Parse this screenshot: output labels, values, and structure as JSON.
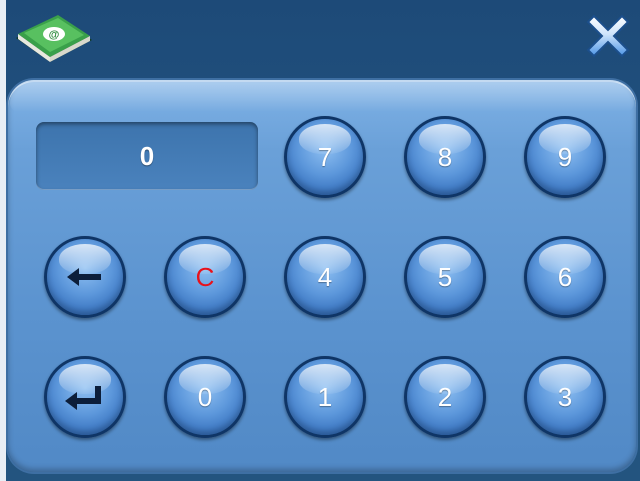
{
  "display": {
    "value": "0"
  },
  "keypad": {
    "row1": [
      "7",
      "8",
      "9"
    ],
    "row2": [
      "C",
      "4",
      "5",
      "6"
    ],
    "row3": [
      "0",
      "1",
      "2",
      "3"
    ]
  },
  "colors": {
    "background": "#23547f",
    "panel": "#5b93cf",
    "key_face": "#5c97db",
    "clear_label": "#e8121b",
    "close_icon": "#5aa0ea"
  },
  "icons": {
    "app": "green-book-icon",
    "close": "close-icon",
    "backspace": "arrow-left-icon",
    "enter": "enter-return-icon"
  }
}
